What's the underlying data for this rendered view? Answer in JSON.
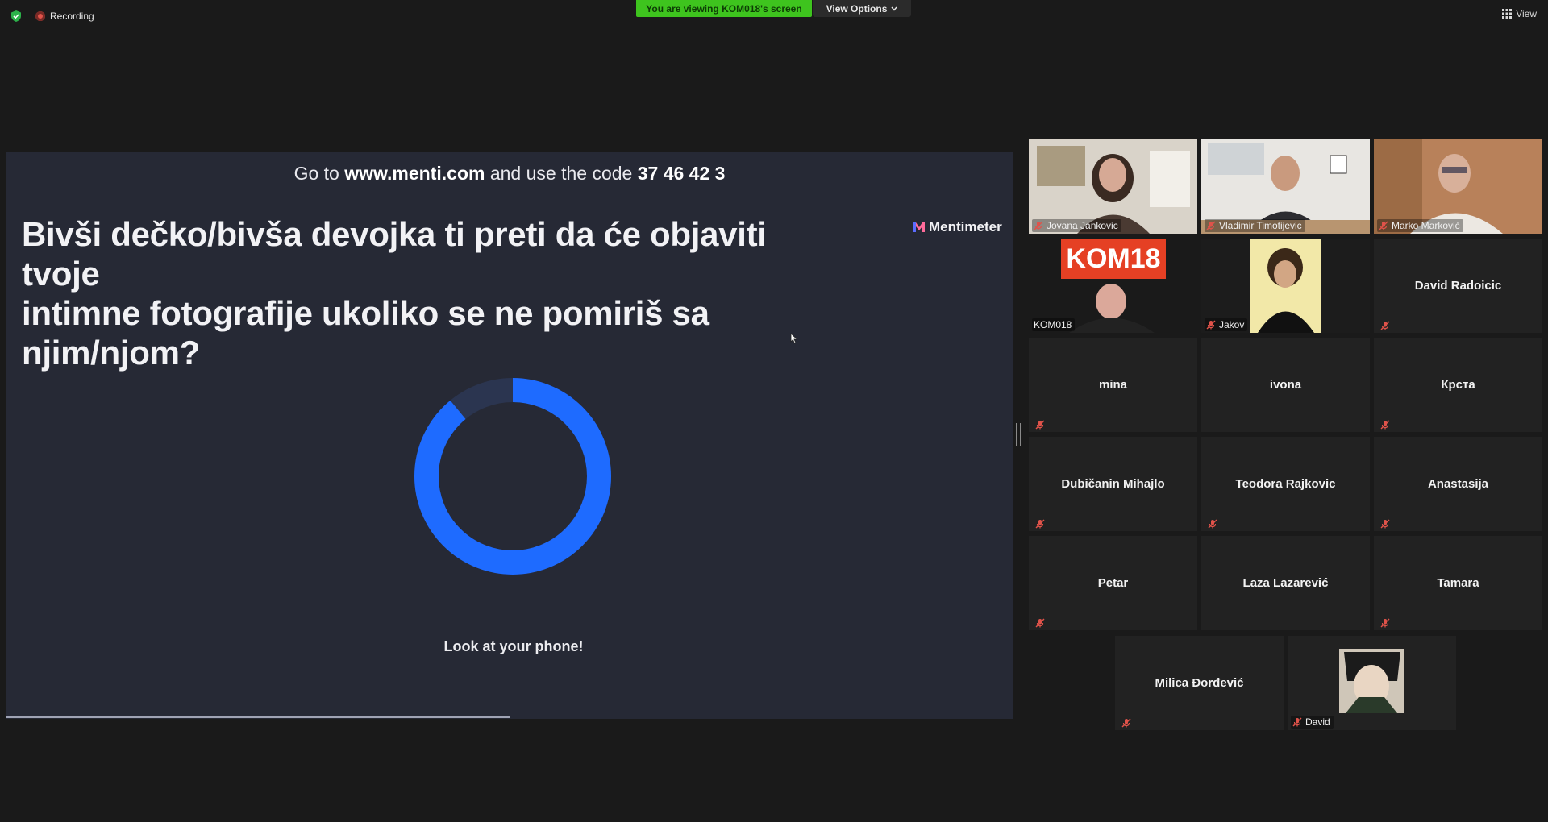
{
  "topbar": {
    "recording_label": "Recording",
    "viewing_banner": "You are viewing KOM018's screen",
    "view_options_label": "View Options",
    "view_label": "View"
  },
  "share": {
    "code_prefix": "Go to ",
    "code_site": "www.menti.com",
    "code_mid": " and use the code ",
    "code_value": "37 46 42 3",
    "question_line1": "Bivši dečko/bivša devojka ti preti da će objaviti tvoje",
    "question_line2": "intimne fotografije ukoliko se ne pomiriš sa njim/njom?",
    "brand": "Mentimeter",
    "phone_message": "Look at your phone!",
    "countdown_fraction": 0.89,
    "progress_fraction": 0.5
  },
  "participants": [
    {
      "name": "Jovana Jankovic",
      "video": true,
      "active": true,
      "muted": true
    },
    {
      "name": "Vladimir Timotijevic",
      "video": true,
      "muted": true
    },
    {
      "name": "Marko Marković",
      "video": true,
      "muted": true
    },
    {
      "name": "KOM018",
      "video": true,
      "muted": false
    },
    {
      "name": "Jakov",
      "video": true,
      "muted": true
    },
    {
      "name": "David Radoicic",
      "video": false,
      "muted": true
    },
    {
      "name": "mina",
      "video": false,
      "muted": true
    },
    {
      "name": "ivona",
      "video": false,
      "muted": false
    },
    {
      "name": "Крста",
      "video": false,
      "muted": true
    },
    {
      "name": "Dubičanin Mihajlo",
      "video": false,
      "muted": true
    },
    {
      "name": "Teodora Rajkovic",
      "video": false,
      "muted": true
    },
    {
      "name": "Anastasija",
      "video": false,
      "muted": true
    },
    {
      "name": "Petar",
      "video": false,
      "muted": true
    },
    {
      "name": "Laza Lazarević",
      "video": false,
      "muted": false
    },
    {
      "name": "Tamara",
      "video": false,
      "muted": true
    },
    {
      "name": "Milica Đorđević",
      "video": false,
      "muted": true
    },
    {
      "name": "David",
      "video": true,
      "muted": true
    }
  ],
  "colors": {
    "accent_green": "#3ec41e",
    "active_speaker": "#c9e03a",
    "menti_blue": "#1e6bff",
    "muted_red": "#e0534a"
  },
  "icons": [
    "shield-icon",
    "recording-icon",
    "chevron-down-icon",
    "grid-icon",
    "muted-mic-icon",
    "mentimeter-logo-icon",
    "cursor-icon"
  ]
}
